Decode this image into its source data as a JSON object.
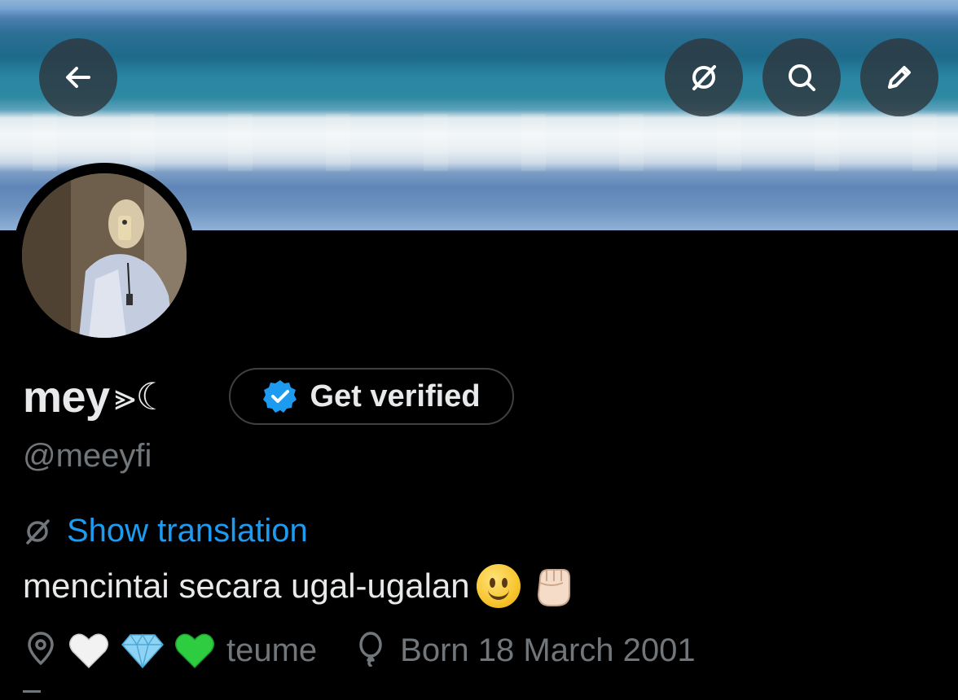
{
  "header": {
    "back_icon": "arrow-left-icon",
    "grok_icon": "grok-icon",
    "search_icon": "search-icon",
    "edit_icon": "edit-pencil-icon"
  },
  "profile": {
    "display_name": "mey",
    "name_glyphs": "⪢☾",
    "verify_button_label": "Get verified",
    "handle": "@meeyfi",
    "translation_link": "Show translation",
    "bio_text": "mencintai secara ugal-ugalan",
    "bio_emojis": [
      "slightly-smiling-face",
      "raised-fist-light-skin"
    ],
    "location_emojis": [
      "white-heart",
      "gem",
      "green-heart"
    ],
    "location_text": "teume",
    "birthday_text": "Born 18 March 2001"
  },
  "colors": {
    "background": "#000000",
    "primary_text": "#e7e9ea",
    "secondary_text": "#71767b",
    "link": "#1d9bf0",
    "verified_badge": "#1d9bf0"
  }
}
